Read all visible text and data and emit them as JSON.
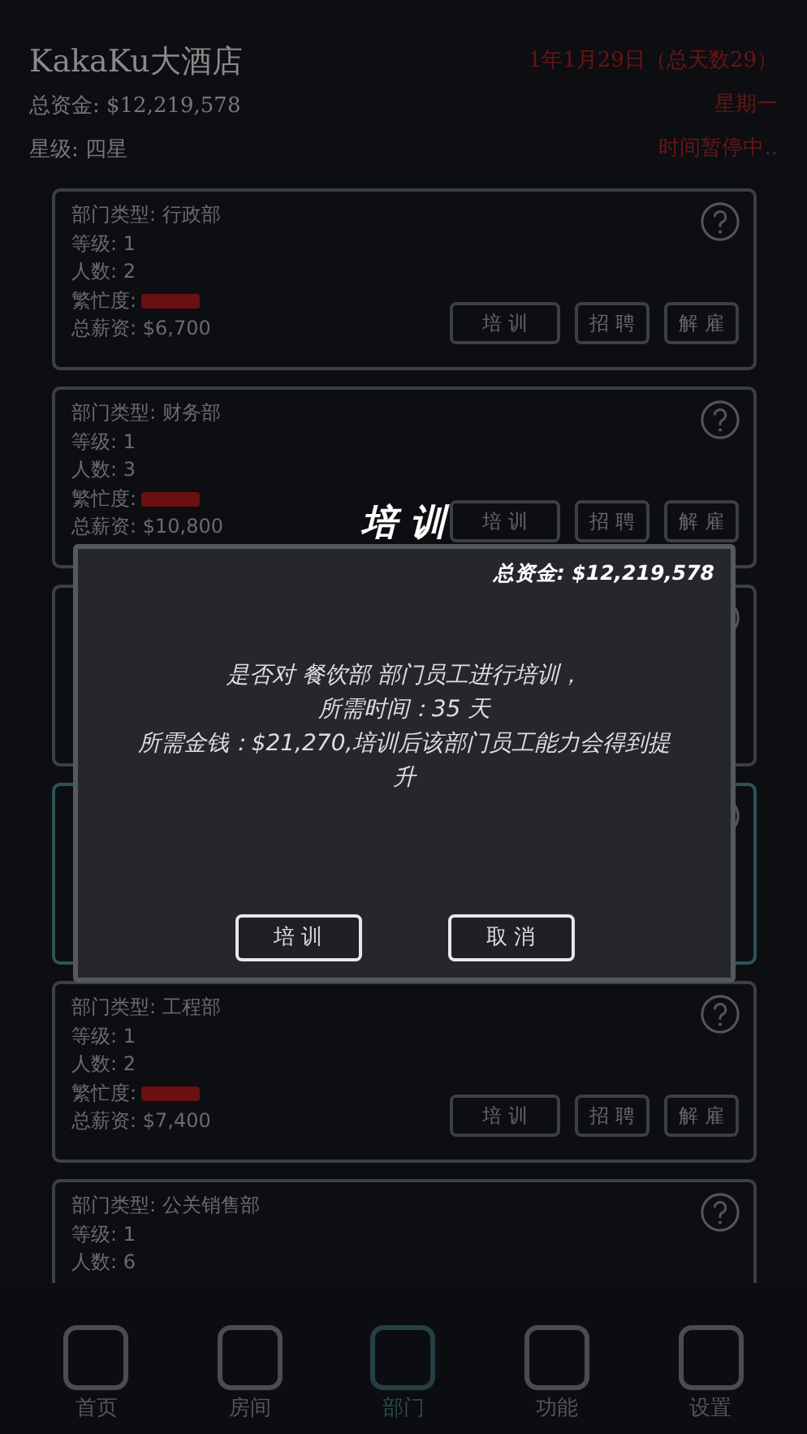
{
  "header": {
    "hotel_name": "KakaKu大酒店",
    "funds": "总资金: $12,219,578",
    "star_rating": "星级: 四星",
    "date": "1年1月29日（总天数29）",
    "weekday": "星期一",
    "time_status": "时间暂停中.."
  },
  "departments": [
    {
      "kind": "card",
      "selected": false,
      "lines": [
        "部门类型: 行政部",
        "等级: 1",
        "人数: 2",
        "繁忙度:",
        "总薪资: $6,700"
      ],
      "buttons": [
        "培 训",
        "招 聘",
        "解 雇"
      ]
    },
    {
      "kind": "card",
      "selected": false,
      "lines": [
        "部门类型: 财务部",
        "等级: 1",
        "人数: 3",
        "繁忙度:",
        "总薪资: $10,800"
      ],
      "buttons": [
        "培 训",
        "招 聘",
        "解 雇"
      ]
    },
    {
      "kind": "covered",
      "selected": false
    },
    {
      "kind": "covered",
      "selected": true
    },
    {
      "kind": "card",
      "selected": false,
      "lines": [
        "部门类型: 工程部",
        "等级: 1",
        "人数: 2",
        "繁忙度:",
        "总薪资: $7,400"
      ],
      "buttons": [
        "培 训",
        "招 聘",
        "解 雇"
      ]
    },
    {
      "kind": "card",
      "selected": false,
      "lines": [
        "部门类型: 公关销售部",
        "等级: 1",
        "人数: 6"
      ]
    }
  ],
  "dialog": {
    "title": "培 训",
    "funds": "总资金: $12,219,578",
    "message": [
      "是否对 餐饮部 部门员工进行培训，",
      "所需时间：35 天",
      "所需金钱：$21,270,培训后该部门员工能力会得到提升"
    ],
    "buttons": [
      "培 训",
      "取 消"
    ]
  },
  "nav": [
    {
      "label": "首页",
      "selected": false
    },
    {
      "label": "房间",
      "selected": false
    },
    {
      "label": "部门",
      "selected": true
    },
    {
      "label": "功能",
      "selected": false
    },
    {
      "label": "设置",
      "selected": false
    }
  ]
}
